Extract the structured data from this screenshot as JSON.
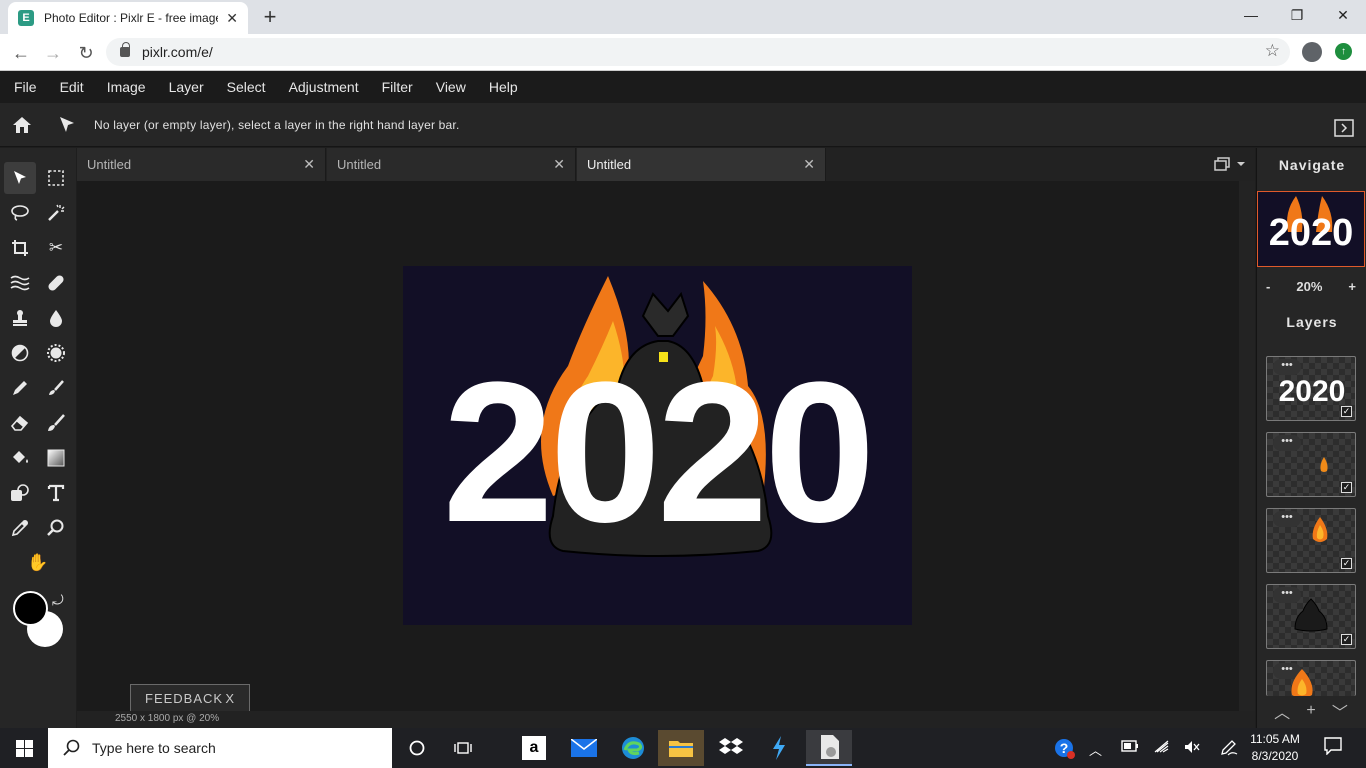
{
  "browser": {
    "tab_title": "Photo Editor : Pixlr E - free image",
    "url": "pixlr.com/e/"
  },
  "menu": [
    "File",
    "Edit",
    "Image",
    "Layer",
    "Select",
    "Adjustment",
    "Filter",
    "View",
    "Help"
  ],
  "options_message": "No layer (or empty layer), select a layer in the right hand layer bar.",
  "doc_tabs": [
    "Untitled",
    "Untitled",
    "Untitled"
  ],
  "canvas": {
    "title_text": "2020",
    "bg_color": "#120f26"
  },
  "status_text": "2550 x 1800 px @ 20%",
  "feedback": {
    "label": "FEEDBACK",
    "close": "X"
  },
  "navigate": {
    "header": "Navigate",
    "zoom": "20%",
    "minus": "-",
    "plus": "+"
  },
  "layers": {
    "header": "Layers",
    "thumb_text": "2020",
    "dots": "•••"
  },
  "taskbar": {
    "search_placeholder": "Type here to search",
    "time": "11:05 AM",
    "date": "8/3/2020"
  },
  "colors": {
    "accent": "#e05a2b",
    "panel": "#262626",
    "canvas_bg": "#1b1b1b"
  }
}
